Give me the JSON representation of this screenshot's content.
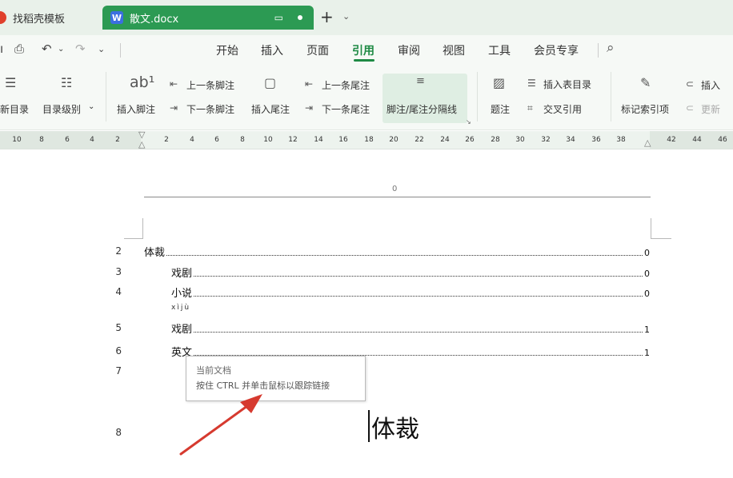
{
  "tabs": {
    "inactive_label": "找稻壳模板",
    "active_icon": "W",
    "active_label": "散文.docx"
  },
  "menu": {
    "items": [
      "开始",
      "插入",
      "页面",
      "引用",
      "审阅",
      "视图",
      "工具",
      "会员专享"
    ],
    "active": "引用"
  },
  "ribbon": {
    "update_toc": "新目录",
    "toc_level": "目录级别",
    "insert_footnote": "插入脚注",
    "prev_footnote": "上一条脚注",
    "next_footnote": "下一条脚注",
    "insert_endnote": "插入尾注",
    "prev_endnote": "上一条尾注",
    "next_endnote": "下一条尾注",
    "separator": "脚注/尾注分隔线",
    "caption": "题注",
    "insert_figure_toc": "插入表目录",
    "cross_ref": "交叉引用",
    "mark_index": "标记索引项",
    "insert_short": "插入",
    "update_short": "更新"
  },
  "ruler": {
    "left_ticks": [
      "10",
      "8",
      "6",
      "4",
      "2"
    ],
    "right_ticks": [
      "2",
      "4",
      "6",
      "8",
      "10",
      "12",
      "14",
      "16",
      "18",
      "20",
      "22",
      "24",
      "26",
      "28",
      "30",
      "32",
      "34",
      "36",
      "38",
      "42",
      "44",
      "46"
    ]
  },
  "document": {
    "header_number": "0",
    "toc_entries": [
      {
        "line": "2",
        "label": "体裁",
        "page": "0"
      },
      {
        "line": "3",
        "label": "戏剧",
        "page": "0"
      },
      {
        "line": "4",
        "label": "小说",
        "page": "0"
      },
      {
        "line": "5",
        "label": "戏剧",
        "page": "1"
      },
      {
        "line": "6",
        "label": "英文",
        "page": "1"
      }
    ],
    "pinyin": "xìjù",
    "line7": "7",
    "line8": "8",
    "heading": "体裁",
    "tooltip": {
      "line1": "当前文档",
      "line2": "按住 CTRL 并单击鼠标以跟踪链接"
    }
  },
  "colors": {
    "accent": "#1e8a44",
    "tab_active": "#2c9a53",
    "arrow": "#d63a2f"
  }
}
